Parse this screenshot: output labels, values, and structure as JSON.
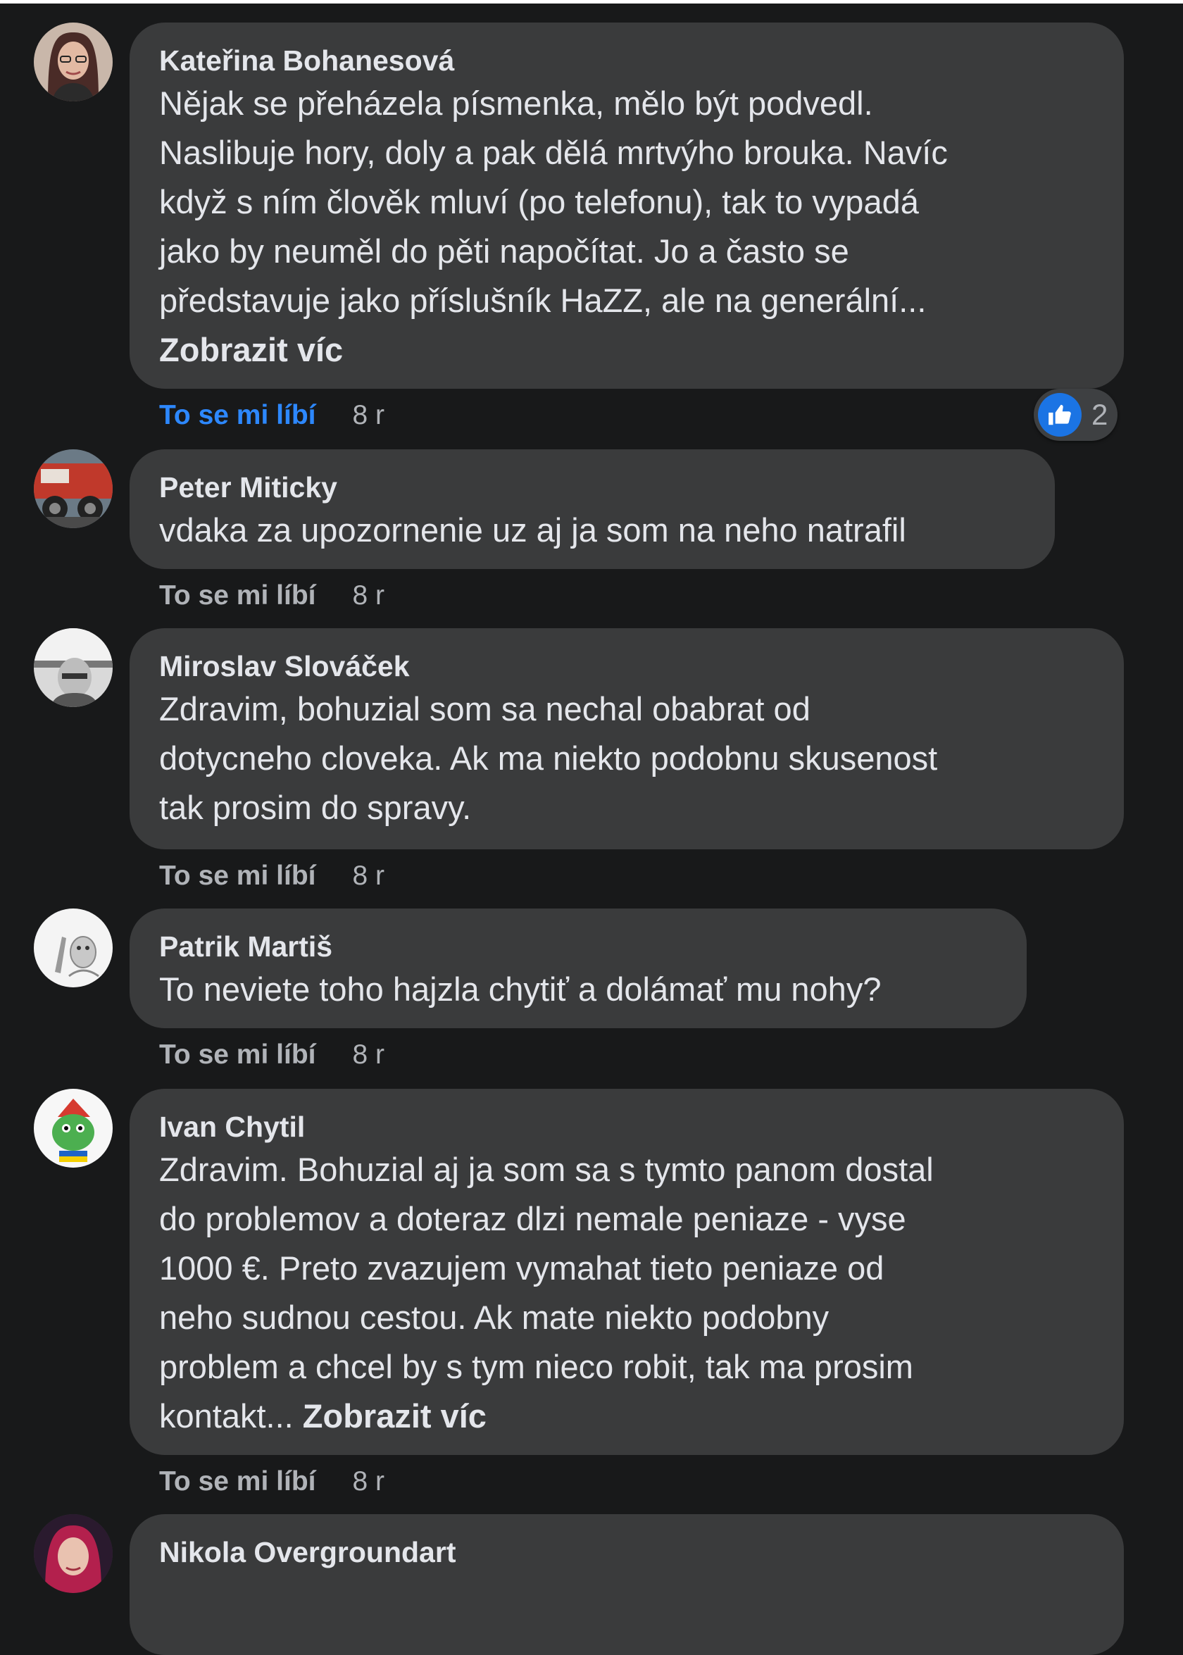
{
  "comments": [
    {
      "author": "Kateřina Bohanesová",
      "lines": [
        "Nějak se přeházela písmenka, mělo být podvedl.",
        "Naslibuje hory, doly a pak dělá mrtvýho brouka. Navíc",
        "když s ním člověk mluví (po telefonu), tak to vypadá",
        "jako by neuměl do pěti napočítat. Jo a často se",
        "představuje jako příslušník HaZZ, ale na generální..."
      ],
      "see_more": "Zobrazit víc",
      "like_label": "To se mi líbí",
      "time": "8 r",
      "reaction_icon": "like-thumb-icon",
      "reaction_count": "2"
    },
    {
      "author": "Peter Miticky",
      "lines": [
        "vdaka za upozornenie uz aj ja som na neho natrafil"
      ],
      "like_label": "To se mi líbí",
      "time": "8 r"
    },
    {
      "author": "Miroslav Slováček",
      "lines": [
        "Zdravim, bohuzial som sa nechal obabrat od",
        "dotycneho cloveka. Ak ma niekto podobnu skusenost",
        "tak prosim do spravy."
      ],
      "like_label": "To se mi líbí",
      "time": "8 r"
    },
    {
      "author": "Patrik Martiš",
      "lines": [
        "To neviete toho hajzla chytiť a dolámať mu nohy?"
      ],
      "like_label": "To se mi líbí",
      "time": "8 r"
    },
    {
      "author": "Ivan Chytil",
      "lines": [
        "Zdravim. Bohuzial aj ja som sa s tymto panom dostal",
        "do problemov a doteraz dlzi nemale peniaze - vyse",
        "1000 €. Preto zvazujem vymahat tieto peniaze od",
        "neho sudnou cestou. Ak mate niekto podobny",
        "problem a chcel by s tym nieco robit, tak ma prosim",
        "kontakt..."
      ],
      "see_more": "Zobrazit víc",
      "like_label": "To se mi líbí",
      "time": "8 r"
    },
    {
      "author": "Nikola Overgroundart"
    }
  ],
  "colors": {
    "background": "#18191a",
    "bubble": "#3a3b3c",
    "link_active": "#2d88ff",
    "meta_text": "#b0b3b8"
  }
}
